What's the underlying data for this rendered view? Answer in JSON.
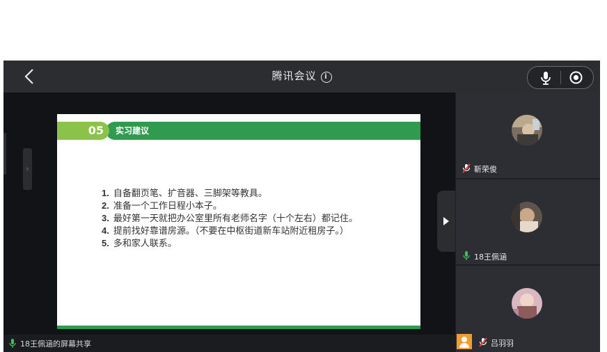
{
  "header": {
    "title": "腾讯会议",
    "info_icon": "i"
  },
  "slide": {
    "number": "05",
    "heading": "实习建议",
    "items": [
      {
        "num": "1.",
        "text": "自备翻页笔、扩音器、三脚架等教具。"
      },
      {
        "num": "2.",
        "text": "准备一个工作日程小本子。"
      },
      {
        "num": "3.",
        "text": "最好第一天就把办公室里所有老师名字（十个左右）都记住。"
      },
      {
        "num": "4.",
        "text": "提前找好靠谱房源。（不要在中枢街道新车站附近租房子。）"
      },
      {
        "num": "5.",
        "text": "多和家人联系。"
      }
    ]
  },
  "share_bar": {
    "label": "18王佩涵的屏幕共享"
  },
  "participants": [
    {
      "name": "靳荣俊",
      "mic": "muted"
    },
    {
      "name": "18王佩涵",
      "mic": "on"
    },
    {
      "name": "吕羽羽",
      "mic": "muted"
    }
  ],
  "colors": {
    "accent_green": "#2e9b4f",
    "light_green": "#8bc34a",
    "mute_red": "#e84c3d",
    "mic_green": "#3cc35a"
  }
}
